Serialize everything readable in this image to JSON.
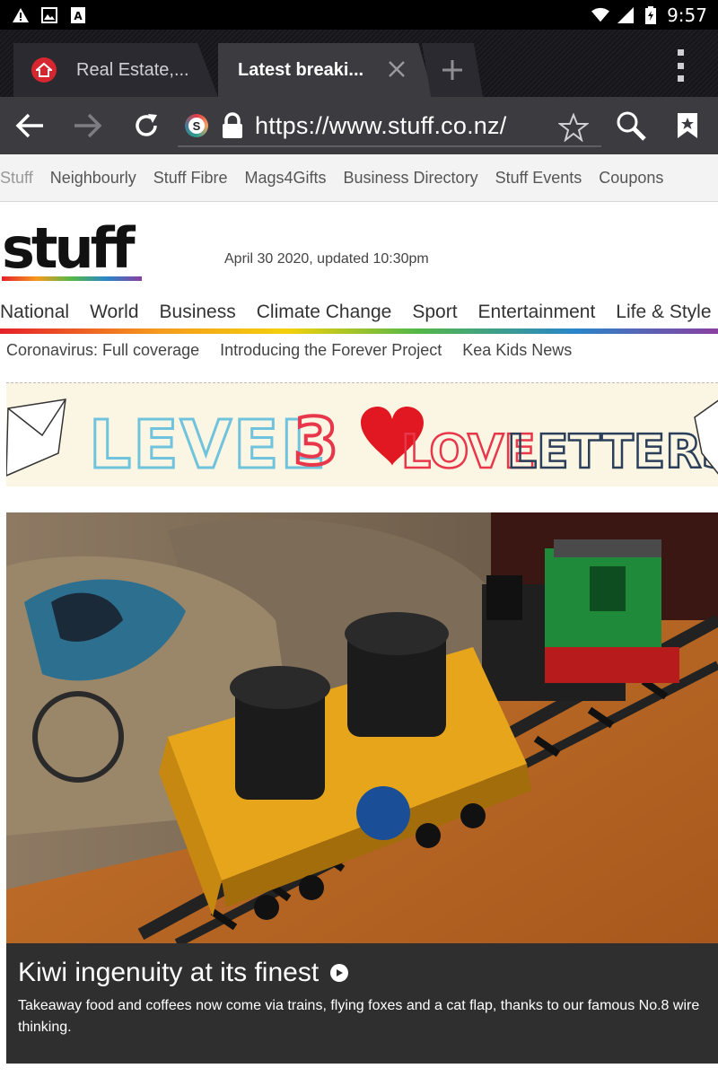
{
  "status_bar": {
    "time": "9:57",
    "left_icons": [
      "warning-icon",
      "image-icon",
      "text-icon"
    ],
    "right_icons": [
      "wifi-icon",
      "signal-icon",
      "battery-icon"
    ]
  },
  "tabs": [
    {
      "label": "Real Estate,...",
      "favicon": "house-icon",
      "active": false
    },
    {
      "label": "Latest breaki...",
      "active": true
    }
  ],
  "toolbar": {
    "url": "https://www.stuff.co.nz/",
    "site_icon_letter": "S"
  },
  "network_links": [
    "Stuff",
    "Neighbourly",
    "Stuff Fibre",
    "Mags4Gifts",
    "Business Directory",
    "Stuff Events",
    "Coupons"
  ],
  "masthead": {
    "logo": "stuff",
    "dateline": "April 30 2020, updated 10:30pm"
  },
  "sections": [
    "National",
    "World",
    "Business",
    "Climate Change",
    "Sport",
    "Entertainment",
    "Life & Style"
  ],
  "subnav": [
    "Coronavirus: Full coverage",
    "Introducing the Forever Project",
    "Kea Kids News"
  ],
  "banner": {
    "word1": "LEVEL",
    "number": "3",
    "word2": "LOVE",
    "word3": "LETTERS",
    "colors": {
      "level": "#6fc3dd",
      "number": "#e8374a",
      "love": "#e8374a",
      "letters": "#3aa6c7"
    }
  },
  "hero": {
    "title": "Kiwi ingenuity at its finest",
    "description": "Takeaway food and coffees now come via trains, flying foxes and a cat flap, thanks to our famous No.8 wire thinking."
  },
  "colors": {
    "brand_rainbow": [
      "#e5212a",
      "#f59a1e",
      "#f4d10b",
      "#54b848",
      "#2a86c9",
      "#8a3fa0"
    ]
  }
}
